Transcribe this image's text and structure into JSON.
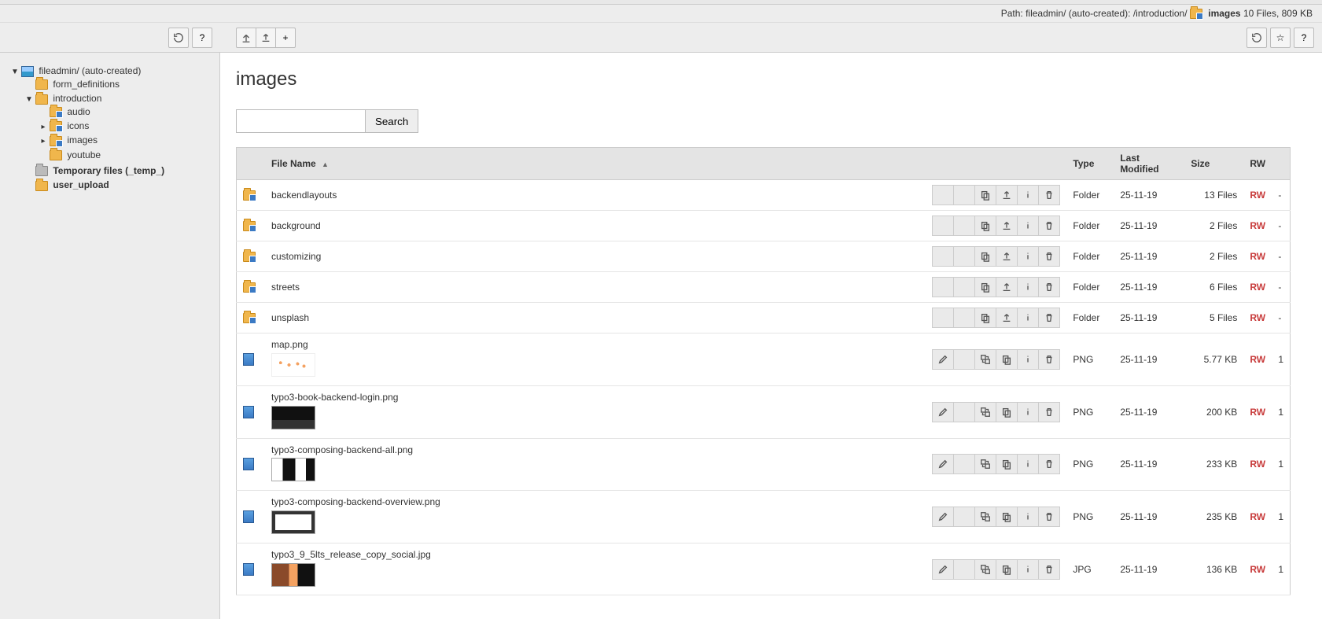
{
  "path": {
    "prefix": "Path: ",
    "segments": [
      "fileadmin/ (auto-created):",
      "/introduction/ "
    ],
    "current": "images",
    "summary": " 10 Files, 809 KB"
  },
  "toolbar": {
    "refresh": "⟳",
    "help": "?",
    "up": "↥",
    "upload": "⇪",
    "new": "+",
    "bookmark": "☆"
  },
  "tree": {
    "root": {
      "label": "fileadmin/ (auto-created)",
      "mount": true,
      "expanded": true
    },
    "children": [
      {
        "label": "form_definitions",
        "type": "folder"
      },
      {
        "label": "introduction",
        "type": "folder",
        "expanded": true,
        "children": [
          {
            "label": "audio",
            "type": "folder-badge"
          },
          {
            "label": "icons",
            "type": "folder-badge",
            "hasChildren": true
          },
          {
            "label": "images",
            "type": "folder-badge",
            "hasChildren": true
          },
          {
            "label": "youtube",
            "type": "folder"
          }
        ]
      },
      {
        "label": "Temporary files (_temp_)",
        "type": "folder-gray",
        "bold": true
      },
      {
        "label": "user_upload",
        "type": "folder",
        "bold": true
      }
    ]
  },
  "page": {
    "title": "images",
    "search_button": "Search"
  },
  "table": {
    "headers": {
      "filename": "File Name",
      "type": "Type",
      "modified": "Last Modified",
      "size": "Size",
      "rw": "RW",
      "ref": ""
    },
    "rows": [
      {
        "icon": "folder-badge",
        "name": "backendlayouts",
        "kind": "folder",
        "type": "Folder",
        "date": "25-11-19",
        "size": "13 Files",
        "rw": "RW",
        "ref": "-"
      },
      {
        "icon": "folder-badge",
        "name": "background",
        "kind": "folder",
        "type": "Folder",
        "date": "25-11-19",
        "size": "2 Files",
        "rw": "RW",
        "ref": "-"
      },
      {
        "icon": "folder-badge",
        "name": "customizing",
        "kind": "folder",
        "type": "Folder",
        "date": "25-11-19",
        "size": "2 Files",
        "rw": "RW",
        "ref": "-"
      },
      {
        "icon": "folder-badge",
        "name": "streets",
        "kind": "folder",
        "type": "Folder",
        "date": "25-11-19",
        "size": "6 Files",
        "rw": "RW",
        "ref": "-"
      },
      {
        "icon": "folder-badge",
        "name": "unsplash",
        "kind": "folder",
        "type": "Folder",
        "date": "25-11-19",
        "size": "5 Files",
        "rw": "RW",
        "ref": "-"
      },
      {
        "icon": "file",
        "name": "map.png",
        "kind": "file",
        "thumb": "map",
        "type": "PNG",
        "date": "25-11-19",
        "size": "5.77 KB",
        "rw": "RW",
        "ref": "1"
      },
      {
        "icon": "file",
        "name": "typo3-book-backend-login.png",
        "kind": "file",
        "thumb": "dark",
        "type": "PNG",
        "date": "25-11-19",
        "size": "200 KB",
        "rw": "RW",
        "ref": "1"
      },
      {
        "icon": "file",
        "name": "typo3-composing-backend-all.png",
        "kind": "file",
        "thumb": "screens",
        "type": "PNG",
        "date": "25-11-19",
        "size": "233 KB",
        "rw": "RW",
        "ref": "1"
      },
      {
        "icon": "file",
        "name": "typo3-composing-backend-overview.png",
        "kind": "file",
        "thumb": "overview",
        "type": "PNG",
        "date": "25-11-19",
        "size": "235 KB",
        "rw": "RW",
        "ref": "1"
      },
      {
        "icon": "file",
        "name": "typo3_9_5lts_release_copy_social.jpg",
        "kind": "file",
        "thumb": "social",
        "type": "JPG",
        "date": "25-11-19",
        "size": "136 KB",
        "rw": "RW",
        "ref": "1"
      }
    ]
  }
}
